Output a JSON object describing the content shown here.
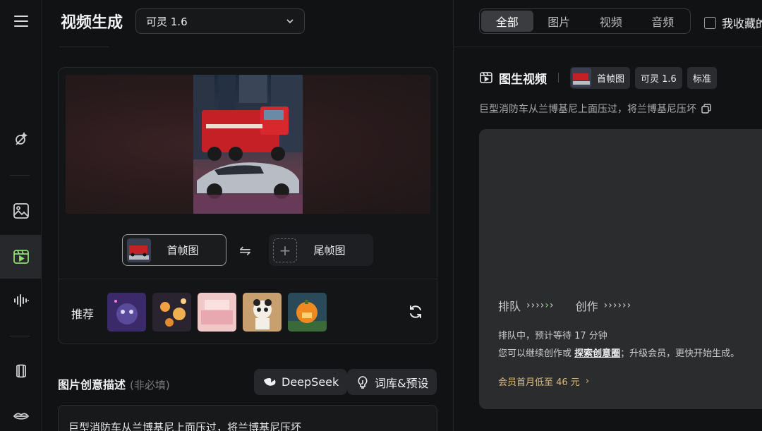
{
  "rail": {
    "items": [
      {
        "name": "magic-wand-icon"
      },
      {
        "name": "image-icon"
      },
      {
        "name": "video-icon",
        "active": true
      },
      {
        "name": "audio-icon"
      },
      {
        "name": "model-icon"
      },
      {
        "name": "lips-icon"
      }
    ]
  },
  "header": {
    "title": "视频生成",
    "model": "可灵 1.6"
  },
  "frames": {
    "first_label": "首帧图",
    "last_label": "尾帧图"
  },
  "recommend": {
    "label": "推荐",
    "thumbs": [
      "space-creature",
      "fire-lanterns",
      "pink-room",
      "panda-toy",
      "pumpkin-house"
    ]
  },
  "description": {
    "title": "图片创意描述",
    "optional": "(非必填)",
    "deepseek_label": "DeepSeek",
    "lexicon_label": "词库&预设",
    "prompt": "巨型消防车从兰博基尼上面压过，将兰博基尼压坏"
  },
  "right": {
    "tabs": [
      {
        "label": "全部",
        "active": true
      },
      {
        "label": "图片"
      },
      {
        "label": "视频"
      },
      {
        "label": "音频"
      }
    ],
    "fav_label": "我收藏的",
    "task": {
      "title": "图生视频",
      "chips": [
        "首帧图",
        "可灵 1.6",
        "标准"
      ],
      "prompt": "巨型消防车从兰博基尼上面压过，将兰博基尼压坏"
    },
    "queue": {
      "queue_label": "排队",
      "create_label": "创作",
      "wait_text": "排队中，预计等待 17 分钟",
      "continue_prefix": "您可以继续创作或 ",
      "explore_link": "探索创意圈",
      "continue_suffix": "；升级会员，更快开始生成。",
      "promo": "会员首月低至 46 元"
    }
  },
  "colors": {
    "accent_green": "#7fe36b",
    "promo_gold": "#d9b87a"
  }
}
